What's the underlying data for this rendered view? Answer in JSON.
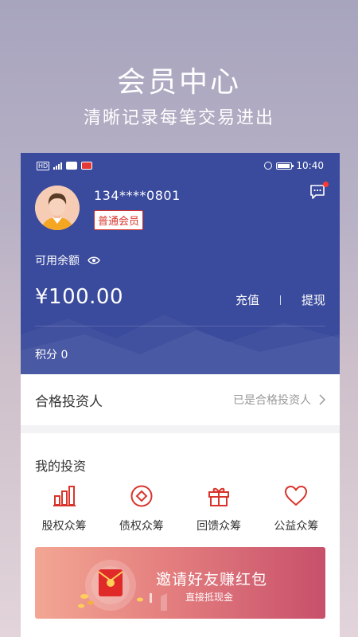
{
  "promo": {
    "title": "会员中心",
    "subtitle": "清晰记录每笔交易进出"
  },
  "status_bar": {
    "time": "10:40",
    "left_label": "HD"
  },
  "profile": {
    "phone": "134****0801",
    "member_level": "普通会员",
    "avatar_icon": "user-avatar-icon",
    "message_icon": "message-icon"
  },
  "balance": {
    "label": "可用余额",
    "amount": "¥100.00",
    "recharge": "充值",
    "withdraw": "提现",
    "points": "积分 0"
  },
  "qualification": {
    "title": "合格投资人",
    "status": "已是合格投资人"
  },
  "investments": {
    "title": "我的投资",
    "items": [
      {
        "label": "股权众筹",
        "icon": "bar-chart-icon"
      },
      {
        "label": "债权众筹",
        "icon": "target-icon"
      },
      {
        "label": "回馈众筹",
        "icon": "gift-icon"
      },
      {
        "label": "公益众筹",
        "icon": "heart-icon"
      }
    ]
  },
  "banner": {
    "title": "邀请好友赚红包",
    "subtitle": "直接抵现金"
  },
  "colors": {
    "header_bg": "#3a4a9c",
    "accent_red": "#d9342b",
    "badge_dot": "#ff3b30"
  }
}
